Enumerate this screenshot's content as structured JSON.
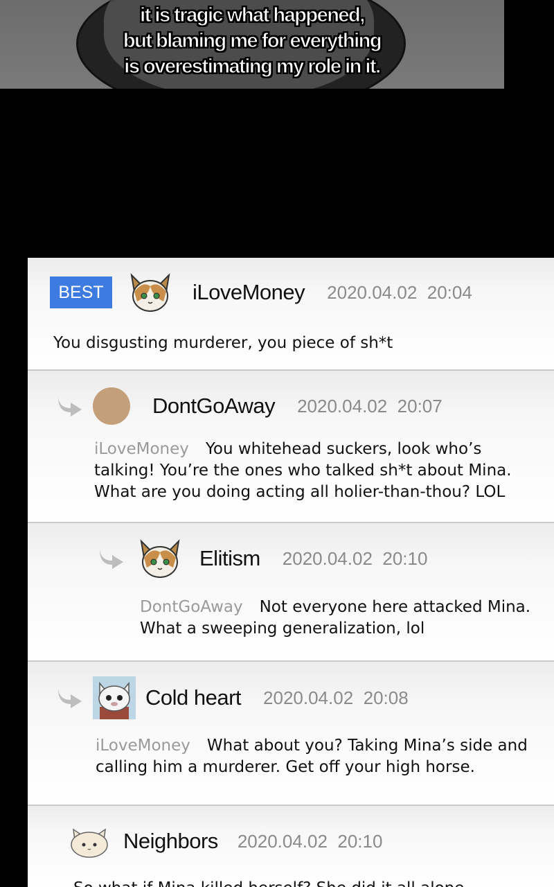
{
  "caption": {
    "lines": [
      "it is tragic what happened,",
      "but blaming me for everything",
      "is overestimating my role in it."
    ]
  },
  "comments": [
    {
      "badge": "BEST",
      "username": "iLoveMoney",
      "timestamp": "2020.04.02  20:04",
      "mention": "",
      "text": "You disgusting murderer, you piece of sh*t",
      "avatar": "calico-cat-avatar"
    },
    {
      "username": "DontGoAway",
      "timestamp": "2020.04.02  20:07",
      "mention": "iLoveMoney",
      "text_lines": [
        "You whitehead suckers, look who’s",
        "talking! You’re the ones who talked sh*t about Mina.",
        "What are you doing acting all holier-than-thou? LOL"
      ],
      "avatar": "tan-circle-avatar"
    },
    {
      "username": "Elitism",
      "timestamp": "2020.04.02  20:10",
      "mention": "DontGoAway",
      "text_lines": [
        "Not everyone here attacked Mina.",
        "What a sweeping generalization, lol"
      ],
      "avatar": "calico-cat-avatar"
    },
    {
      "username": "Cold heart",
      "timestamp": "2020.04.02  20:08",
      "mention": "iLoveMoney",
      "text_lines": [
        "What about you? Taking Mina’s side and",
        "calling him a murderer. Get off your high horse."
      ],
      "avatar": "white-cat-avatar"
    },
    {
      "username": "Neighbors",
      "timestamp": "2020.04.02  20:10",
      "mention": "",
      "text": "So what if Mina killed herself? She did it all alone.",
      "avatar": "cream-cat-avatar"
    }
  ],
  "colors": {
    "best_badge": "#3d7be0",
    "mention": "#9a9a9a",
    "timestamp": "#8a8a8a",
    "reply_arrow": "#bdbdbd"
  }
}
